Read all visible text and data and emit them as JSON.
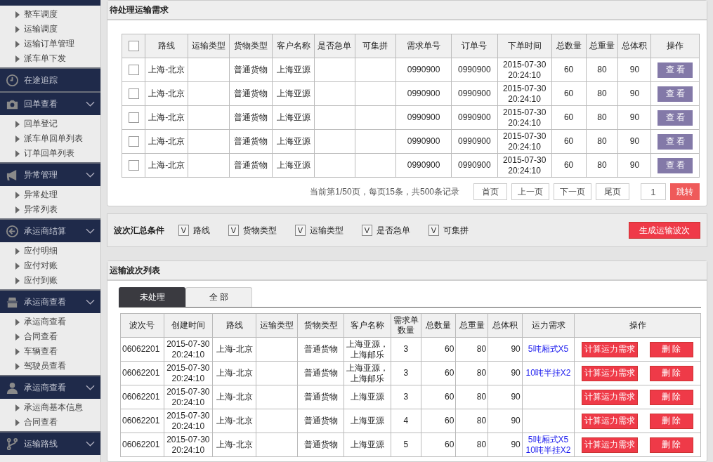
{
  "sidebar": {
    "top_items": [
      "整车调度",
      "运输调度",
      "运输订单管理",
      "派车单下发"
    ],
    "groups": [
      {
        "label": "在途追踪",
        "kind": "clock",
        "collapsible": false
      },
      {
        "label": "回单查看",
        "kind": "camera",
        "collapsible": true,
        "items": [
          "回单登记",
          "派车单回单列表",
          "订单回单列表"
        ]
      },
      {
        "label": "异常管理",
        "kind": "megaphone",
        "collapsible": true,
        "items": [
          "异常处理",
          "异常列表"
        ]
      },
      {
        "label": "承运商结算",
        "kind": "back",
        "collapsible": true,
        "items": [
          "应付明细",
          "应付对账",
          "应付到账"
        ]
      },
      {
        "label": "承运商查看",
        "kind": "agent",
        "collapsible": true,
        "items": [
          "承运商查看",
          "合同查看",
          "车辆查看",
          "驾驶员查看"
        ]
      },
      {
        "label": "承运商查看",
        "kind": "person",
        "collapsible": true,
        "items": [
          "承运商基本信息",
          "合同查看"
        ]
      },
      {
        "label": "运输路线",
        "kind": "branch",
        "collapsible": true
      }
    ]
  },
  "pending": {
    "title": "待处理运输需求",
    "columns": [
      "路线",
      "运输类型",
      "货物类型",
      "客户名称",
      "是否急单",
      "可集拼",
      "需求单号",
      "订单号",
      "下单时间",
      "总数量",
      "总重量",
      "总体积",
      "操作"
    ],
    "all_checked": false,
    "rows": [
      {
        "checked": false,
        "route": "上海-北京",
        "cargo_type": "普通货物",
        "customer": "上海亚源",
        "demand_no": "0990900",
        "order_no": "0990900",
        "time": "2015-07-30 20:24:10",
        "qty": "60",
        "weight": "80",
        "volume": "90",
        "action": "查 看"
      },
      {
        "checked": false,
        "route": "上海-北京",
        "cargo_type": "普通货物",
        "customer": "上海亚源",
        "demand_no": "0990900",
        "order_no": "0990900",
        "time": "2015-07-30 20:24:10",
        "qty": "60",
        "weight": "80",
        "volume": "90",
        "action": "查 看"
      },
      {
        "checked": false,
        "route": "上海-北京",
        "cargo_type": "普通货物",
        "customer": "上海亚源",
        "demand_no": "0990900",
        "order_no": "0990900",
        "time": "2015-07-30 20:24:10",
        "qty": "60",
        "weight": "80",
        "volume": "90",
        "action": "查 看"
      },
      {
        "checked": false,
        "route": "上海-北京",
        "cargo_type": "普通货物",
        "customer": "上海亚源",
        "demand_no": "0990900",
        "order_no": "0990900",
        "time": "2015-07-30 20:24:10",
        "qty": "60",
        "weight": "80",
        "volume": "90",
        "action": "查 看"
      },
      {
        "checked": false,
        "route": "上海-北京",
        "cargo_type": "普通货物",
        "customer": "上海亚源",
        "demand_no": "0990900",
        "order_no": "0990900",
        "time": "2015-07-30 20:24:10",
        "qty": "60",
        "weight": "80",
        "volume": "90",
        "action": "查 看"
      }
    ],
    "pagination": {
      "info": "当前第1/50页，每页15条，共500条记录",
      "buttons": [
        "首页",
        "上一页",
        "下一页",
        "尾页"
      ],
      "page_value": "1",
      "go": "跳转"
    }
  },
  "filters": {
    "label": "波次汇总条件",
    "options": [
      {
        "label": "路线",
        "checked": true,
        "check_glyph": "V"
      },
      {
        "label": "货物类型",
        "checked": true,
        "check_glyph": "V"
      },
      {
        "label": "运输类型",
        "checked": true,
        "check_glyph": "V"
      },
      {
        "label": "是否急单",
        "checked": true,
        "check_glyph": "V"
      },
      {
        "label": "可集拼",
        "checked": true,
        "check_glyph": "V"
      }
    ],
    "generate_button": "生成运输波次"
  },
  "waves": {
    "title": "运输波次列表",
    "tabs": [
      {
        "label": "未处理",
        "selected": true
      },
      {
        "label": "全 部",
        "selected": false
      }
    ],
    "columns": [
      "波次号",
      "创建时间",
      "路线",
      "运输类型",
      "货物类型",
      "客户名称",
      "需求单数量",
      "总数量",
      "总重量",
      "总体积",
      "运力需求",
      "操作"
    ],
    "rows": [
      {
        "wave_no": "06062201",
        "created": "2015-07-30 20:24:10",
        "route": "上海-北京",
        "cargo_type": "普通货物",
        "customer": "上海亚源，上海邮乐",
        "demand_count": "3",
        "qty": "60",
        "weight": "80",
        "volume": "90",
        "capacity": [
          "5吨厢式X5"
        ],
        "calc": "计算运力需求",
        "delete": "删 除"
      },
      {
        "wave_no": "06062201",
        "created": "2015-07-30 20:24:10",
        "route": "上海-北京",
        "cargo_type": "普通货物",
        "customer": "上海亚源，上海邮乐",
        "demand_count": "3",
        "qty": "60",
        "weight": "80",
        "volume": "90",
        "capacity": [
          "10吨半挂X2"
        ],
        "calc": "计算运力需求",
        "delete": "删 除"
      },
      {
        "wave_no": "06062201",
        "created": "2015-07-30 20:24:10",
        "route": "上海-北京",
        "cargo_type": "普通货物",
        "customer": "上海亚源",
        "demand_count": "3",
        "qty": "60",
        "weight": "80",
        "volume": "90",
        "calc": "计算运力需求",
        "delete": "删 除"
      },
      {
        "wave_no": "06062201",
        "created": "2015-07-30 20:24:10",
        "route": "上海-北京",
        "cargo_type": "普通货物",
        "customer": "上海亚源",
        "demand_count": "4",
        "qty": "60",
        "weight": "80",
        "volume": "90",
        "calc": "计算运力需求",
        "delete": "删 除"
      },
      {
        "wave_no": "06062201",
        "created": "2015-07-30 20:24:10",
        "route": "上海-北京",
        "cargo_type": "普通货物",
        "customer": "上海亚源",
        "demand_count": "5",
        "qty": "60",
        "weight": "80",
        "volume": "90",
        "capacity": [
          "5吨厢式X5",
          "10吨半挂X2"
        ],
        "calc": "计算运力需求",
        "delete": "删 除"
      }
    ]
  }
}
